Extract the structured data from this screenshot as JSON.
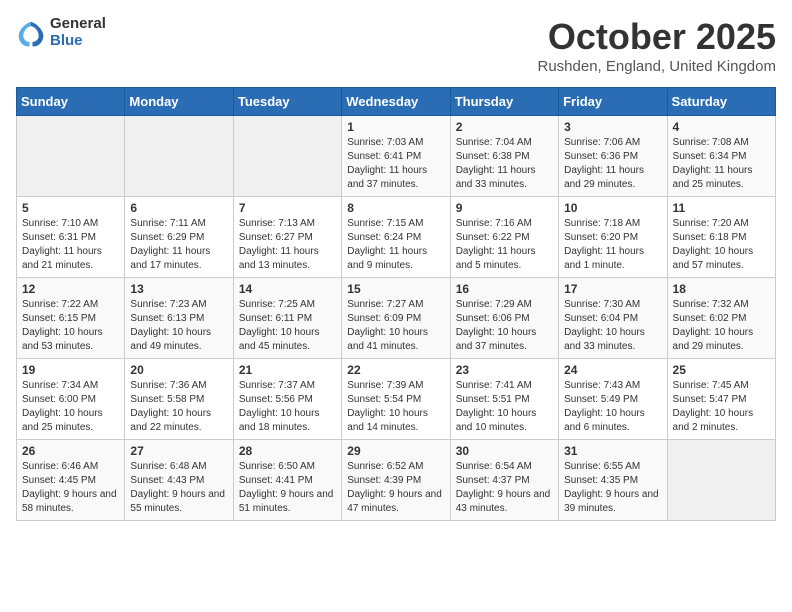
{
  "logo": {
    "general": "General",
    "blue": "Blue"
  },
  "title": "October 2025",
  "location": "Rushden, England, United Kingdom",
  "headers": [
    "Sunday",
    "Monday",
    "Tuesday",
    "Wednesday",
    "Thursday",
    "Friday",
    "Saturday"
  ],
  "weeks": [
    [
      {
        "day": "",
        "info": ""
      },
      {
        "day": "",
        "info": ""
      },
      {
        "day": "",
        "info": ""
      },
      {
        "day": "1",
        "info": "Sunrise: 7:03 AM\nSunset: 6:41 PM\nDaylight: 11 hours\nand 37 minutes."
      },
      {
        "day": "2",
        "info": "Sunrise: 7:04 AM\nSunset: 6:38 PM\nDaylight: 11 hours\nand 33 minutes."
      },
      {
        "day": "3",
        "info": "Sunrise: 7:06 AM\nSunset: 6:36 PM\nDaylight: 11 hours\nand 29 minutes."
      },
      {
        "day": "4",
        "info": "Sunrise: 7:08 AM\nSunset: 6:34 PM\nDaylight: 11 hours\nand 25 minutes."
      }
    ],
    [
      {
        "day": "5",
        "info": "Sunrise: 7:10 AM\nSunset: 6:31 PM\nDaylight: 11 hours\nand 21 minutes."
      },
      {
        "day": "6",
        "info": "Sunrise: 7:11 AM\nSunset: 6:29 PM\nDaylight: 11 hours\nand 17 minutes."
      },
      {
        "day": "7",
        "info": "Sunrise: 7:13 AM\nSunset: 6:27 PM\nDaylight: 11 hours\nand 13 minutes."
      },
      {
        "day": "8",
        "info": "Sunrise: 7:15 AM\nSunset: 6:24 PM\nDaylight: 11 hours\nand 9 minutes."
      },
      {
        "day": "9",
        "info": "Sunrise: 7:16 AM\nSunset: 6:22 PM\nDaylight: 11 hours\nand 5 minutes."
      },
      {
        "day": "10",
        "info": "Sunrise: 7:18 AM\nSunset: 6:20 PM\nDaylight: 11 hours\nand 1 minute."
      },
      {
        "day": "11",
        "info": "Sunrise: 7:20 AM\nSunset: 6:18 PM\nDaylight: 10 hours\nand 57 minutes."
      }
    ],
    [
      {
        "day": "12",
        "info": "Sunrise: 7:22 AM\nSunset: 6:15 PM\nDaylight: 10 hours\nand 53 minutes."
      },
      {
        "day": "13",
        "info": "Sunrise: 7:23 AM\nSunset: 6:13 PM\nDaylight: 10 hours\nand 49 minutes."
      },
      {
        "day": "14",
        "info": "Sunrise: 7:25 AM\nSunset: 6:11 PM\nDaylight: 10 hours\nand 45 minutes."
      },
      {
        "day": "15",
        "info": "Sunrise: 7:27 AM\nSunset: 6:09 PM\nDaylight: 10 hours\nand 41 minutes."
      },
      {
        "day": "16",
        "info": "Sunrise: 7:29 AM\nSunset: 6:06 PM\nDaylight: 10 hours\nand 37 minutes."
      },
      {
        "day": "17",
        "info": "Sunrise: 7:30 AM\nSunset: 6:04 PM\nDaylight: 10 hours\nand 33 minutes."
      },
      {
        "day": "18",
        "info": "Sunrise: 7:32 AM\nSunset: 6:02 PM\nDaylight: 10 hours\nand 29 minutes."
      }
    ],
    [
      {
        "day": "19",
        "info": "Sunrise: 7:34 AM\nSunset: 6:00 PM\nDaylight: 10 hours\nand 25 minutes."
      },
      {
        "day": "20",
        "info": "Sunrise: 7:36 AM\nSunset: 5:58 PM\nDaylight: 10 hours\nand 22 minutes."
      },
      {
        "day": "21",
        "info": "Sunrise: 7:37 AM\nSunset: 5:56 PM\nDaylight: 10 hours\nand 18 minutes."
      },
      {
        "day": "22",
        "info": "Sunrise: 7:39 AM\nSunset: 5:54 PM\nDaylight: 10 hours\nand 14 minutes."
      },
      {
        "day": "23",
        "info": "Sunrise: 7:41 AM\nSunset: 5:51 PM\nDaylight: 10 hours\nand 10 minutes."
      },
      {
        "day": "24",
        "info": "Sunrise: 7:43 AM\nSunset: 5:49 PM\nDaylight: 10 hours\nand 6 minutes."
      },
      {
        "day": "25",
        "info": "Sunrise: 7:45 AM\nSunset: 5:47 PM\nDaylight: 10 hours\nand 2 minutes."
      }
    ],
    [
      {
        "day": "26",
        "info": "Sunrise: 6:46 AM\nSunset: 4:45 PM\nDaylight: 9 hours\nand 58 minutes."
      },
      {
        "day": "27",
        "info": "Sunrise: 6:48 AM\nSunset: 4:43 PM\nDaylight: 9 hours\nand 55 minutes."
      },
      {
        "day": "28",
        "info": "Sunrise: 6:50 AM\nSunset: 4:41 PM\nDaylight: 9 hours\nand 51 minutes."
      },
      {
        "day": "29",
        "info": "Sunrise: 6:52 AM\nSunset: 4:39 PM\nDaylight: 9 hours\nand 47 minutes."
      },
      {
        "day": "30",
        "info": "Sunrise: 6:54 AM\nSunset: 4:37 PM\nDaylight: 9 hours\nand 43 minutes."
      },
      {
        "day": "31",
        "info": "Sunrise: 6:55 AM\nSunset: 4:35 PM\nDaylight: 9 hours\nand 39 minutes."
      },
      {
        "day": "",
        "info": ""
      }
    ]
  ]
}
